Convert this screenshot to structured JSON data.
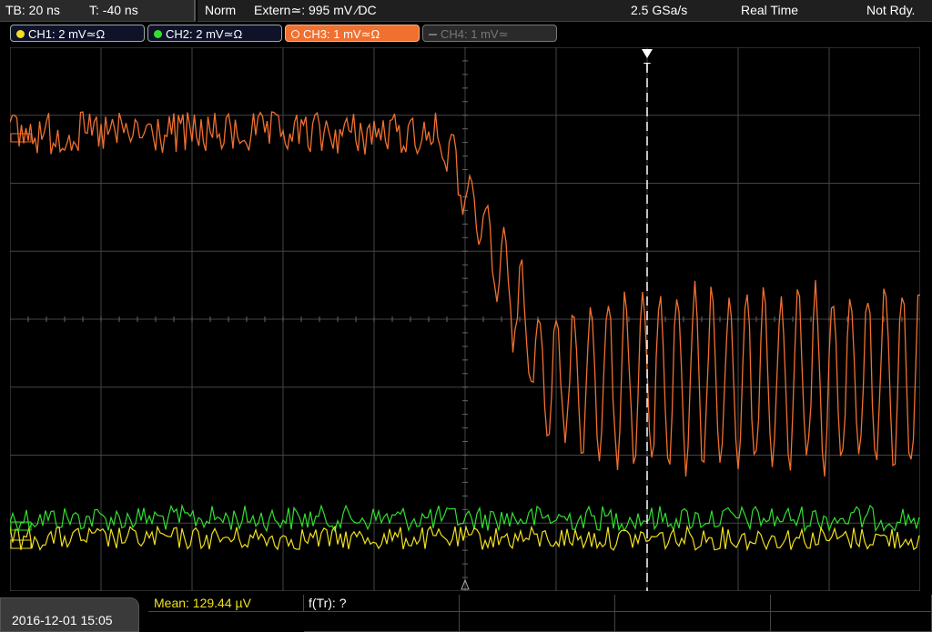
{
  "status_left": {
    "timebase": "TB: 20 ns",
    "trigger_time": "T: -40 ns"
  },
  "status_right": {
    "mode": "Norm",
    "trigger_source": "Extern≃: 995 mV ∕DC",
    "sample_rate": "2.5 GSa/s",
    "acquisition": "Real Time",
    "state": "Not Rdy."
  },
  "channels": [
    {
      "label": "CH1: 2 mV≃Ω",
      "color": "#f0e020",
      "active": true
    },
    {
      "label": "CH2: 2 mV≃Ω",
      "color": "#30e030",
      "active": true
    },
    {
      "label": "CH3: 1 mV≃Ω",
      "color": "#f07030",
      "active": true
    },
    {
      "label": "CH4: 1 mV≃",
      "color": "#888888",
      "active": false
    }
  ],
  "trigger_marker": "T",
  "date": "2016-12-01 15:05",
  "measurements": {
    "mean": "Mean: 129.44 µV",
    "ftr": "f(Tr): ?"
  },
  "colors": {
    "ch1": "#f0e020",
    "ch2": "#30e030",
    "ch3": "#f07030",
    "grid": "#444444"
  }
}
